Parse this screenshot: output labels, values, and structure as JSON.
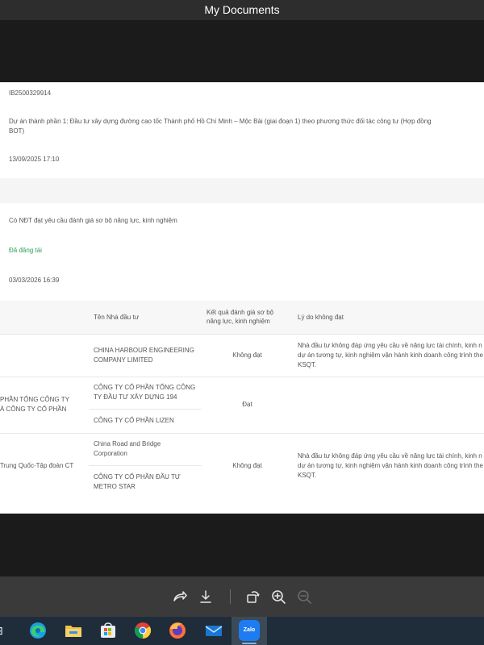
{
  "window": {
    "title": "My Documents"
  },
  "document": {
    "code": "IB2500329914",
    "project_line1": "Dự án thành phần 1: Đầu tư xây dựng đường cao tốc Thành phố Hồ Chí Minh – Mộc Bài (giai đoạn 1) theo phương thức đối tác công tư (Hợp đồng",
    "project_line2": "BOT)",
    "date1": "13/09/2025 17:10",
    "requirement": "Có NĐT đạt yêu cầu đánh giá sơ bộ năng lực, kinh nghiệm",
    "status": "Đã đăng tải",
    "date2": "03/03/2026 16:39"
  },
  "table": {
    "headers": {
      "investor": "Tên Nhà đầu tư",
      "result_line1": "Kết quả đánh giá sơ bộ",
      "result_line2": "năng lực, kinh nghiệm",
      "reason": "Lý do không đạt"
    },
    "rows": [
      {
        "left": "",
        "investor_line1": "CHINA HARBOUR ENGINEERING",
        "investor_line2": "COMPANY LIMITED",
        "result": "Không đạt",
        "reason_line1": "Nhà đầu tư không đáp ứng yêu cầu về năng lực tài chính, kinh n",
        "reason_line2": "dự án tương tự, kinh nghiệm vận hành kinh doanh công trình the",
        "reason_line3": "KSQT."
      },
      {
        "left_line1": "PHẦN TỔNG CÔNG TY",
        "left_line2": "À CÔNG TY CỔ PHẦN",
        "investor_line1": "CÔNG TY CỔ PHẦN TỔNG CÔNG",
        "investor_line2": "TY ĐẦU TƯ XÂY DỰNG 194",
        "investor2": "CÔNG TY CỔ PHẦN LIZEN",
        "result": "Đạt"
      },
      {
        "left": "Trung Quốc-Tập đoàn CT",
        "investor_line1": "China Road and Bridge",
        "investor_line2": "Corporation",
        "investor2_line1": "CÔNG TY CỔ PHẦN ĐẦU TƯ",
        "investor2_line2": "METRO STAR",
        "result": "Không đạt",
        "reason_line1": "Nhà đầu tư không đáp ứng yêu cầu về năng lực tài chính, kinh n",
        "reason_line2": "dự án tương tự, kinh nghiệm vận hành kinh doanh công trình the",
        "reason_line3": "KSQT."
      }
    ]
  },
  "toolbar": {
    "icons": [
      "share-icon",
      "download-icon",
      "rotate-icon",
      "zoom-in-icon",
      "zoom-out-icon"
    ]
  },
  "taskbar": {
    "apps": [
      "edge",
      "file-explorer",
      "microsoft-store",
      "chrome",
      "firefox",
      "mail",
      "zalo"
    ],
    "zalo_label": "Zalo"
  },
  "colors": {
    "accent_green": "#2e9e5a",
    "taskbar": "#1f2c3a",
    "zalo_blue": "#1e7cf2"
  }
}
